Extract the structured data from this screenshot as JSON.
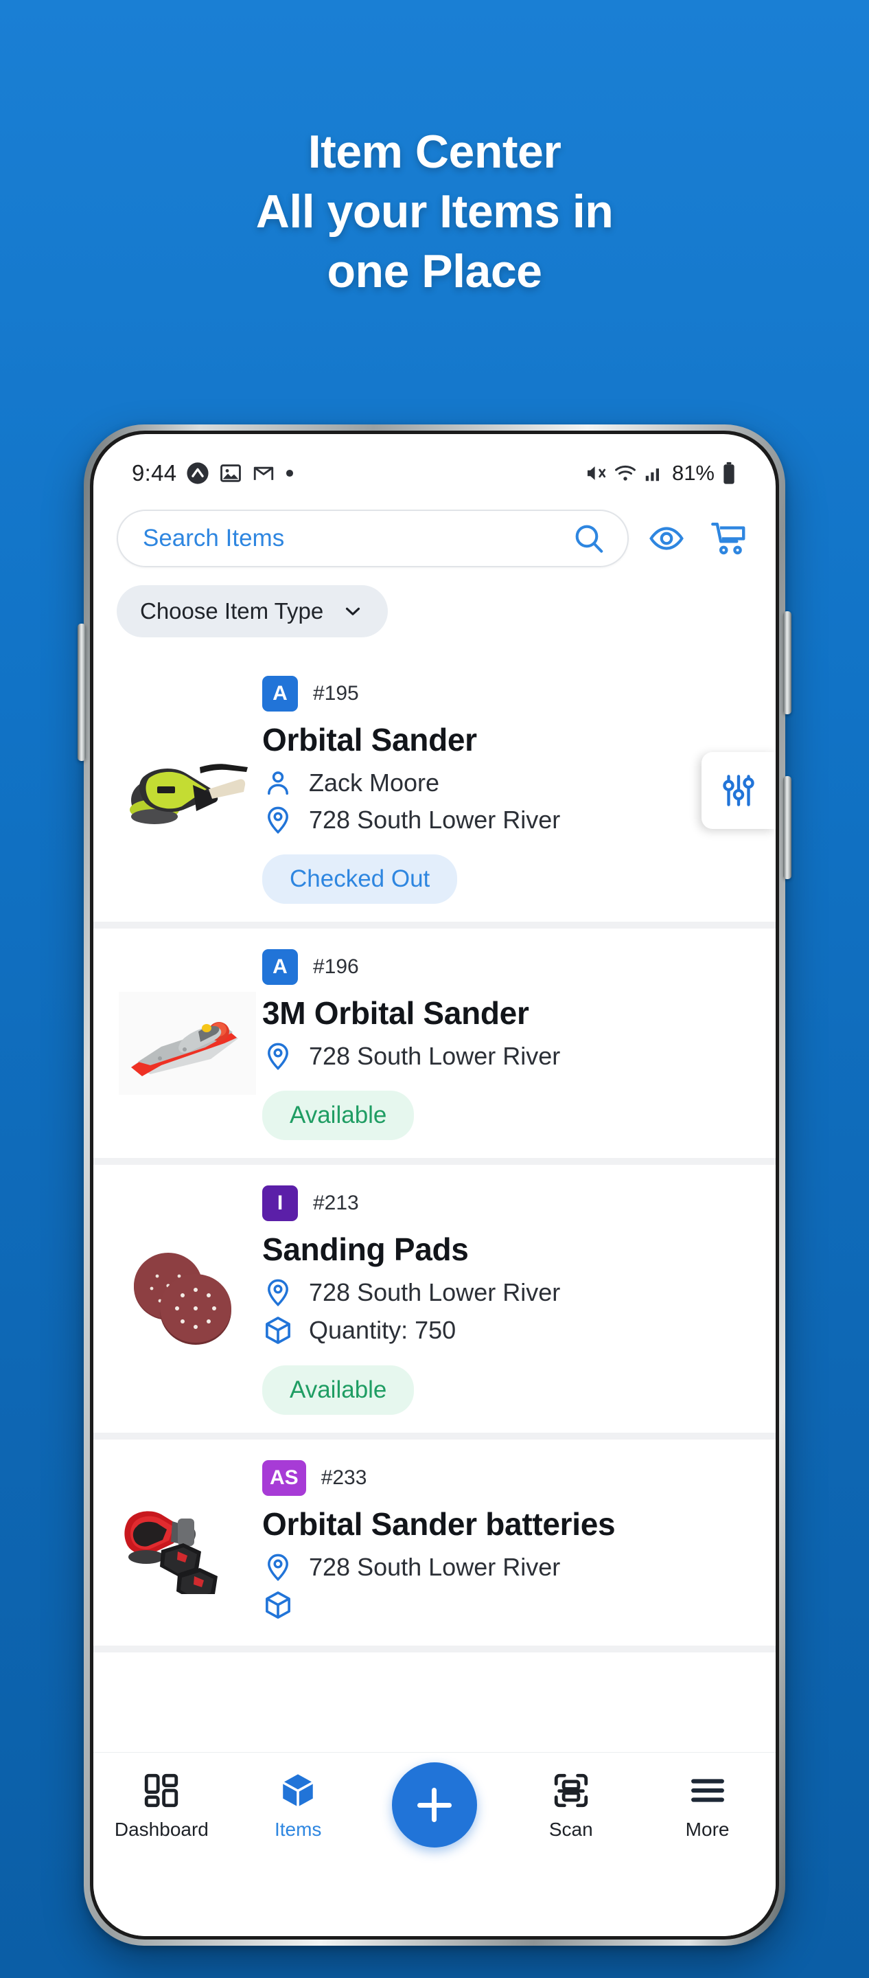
{
  "promo": {
    "line1": "Item Center",
    "line2": "All your Items in",
    "line3": "one Place"
  },
  "colors": {
    "background_top": "#1a7fd4",
    "background_bottom": "#0b5ea6",
    "accent": "#2174d8",
    "available_text": "#1f9d63",
    "available_bg": "#e6f7ee",
    "checked_out_text": "#2e86e0",
    "checked_out_bg": "#e3eefb"
  },
  "status_bar": {
    "time": "9:44",
    "icons_left": [
      "nova-launcher-icon",
      "photos-icon",
      "gmail-icon",
      "dot-icon"
    ],
    "icons_right": [
      "mute-icon",
      "wifi-icon",
      "signal-icon"
    ],
    "battery_percent": "81%"
  },
  "search": {
    "placeholder": "Search Items",
    "search_icon": "search-icon",
    "eye_icon": "eye-icon",
    "cart_icon": "cart-icon"
  },
  "filters": {
    "item_type_label": "Choose Item Type",
    "chevron_icon": "chevron-down-icon",
    "sliders_icon": "sliders-icon"
  },
  "items": [
    {
      "tag": "A",
      "tag_color": "blue",
      "id": "#195",
      "title": "Orbital Sander",
      "thumb": "orbital-sander-image",
      "assignee": "Zack Moore",
      "location": "728 South Lower River",
      "quantity": null,
      "status": "Checked Out",
      "status_kind": "out"
    },
    {
      "tag": "A",
      "tag_color": "blue",
      "id": "#196",
      "title": "3M Orbital Sander",
      "thumb": "3m-orbital-sander-image",
      "assignee": null,
      "location": "728 South Lower River",
      "quantity": null,
      "status": "Available",
      "status_kind": "avail"
    },
    {
      "tag": "I",
      "tag_color": "purple-d",
      "id": "#213",
      "title": "Sanding Pads",
      "thumb": "sanding-pads-image",
      "assignee": null,
      "location": "728 South Lower River",
      "quantity": "Quantity: 750",
      "status": "Available",
      "status_kind": "avail"
    },
    {
      "tag": "AS",
      "tag_color": "purple-l",
      "id": "#233",
      "title": "Orbital Sander batteries",
      "thumb": "orbital-sander-batteries-image",
      "assignee": null,
      "location": "728 South Lower River",
      "quantity": null,
      "status": null,
      "status_kind": null
    }
  ],
  "bottom_nav": [
    {
      "label": "Dashboard",
      "icon": "dashboard-icon",
      "active": false
    },
    {
      "label": "Items",
      "icon": "box-icon",
      "active": true
    },
    {
      "label": "",
      "icon": "plus-icon",
      "active": false
    },
    {
      "label": "Scan",
      "icon": "scan-icon",
      "active": false
    },
    {
      "label": "More",
      "icon": "hamburger-icon",
      "active": false
    }
  ]
}
